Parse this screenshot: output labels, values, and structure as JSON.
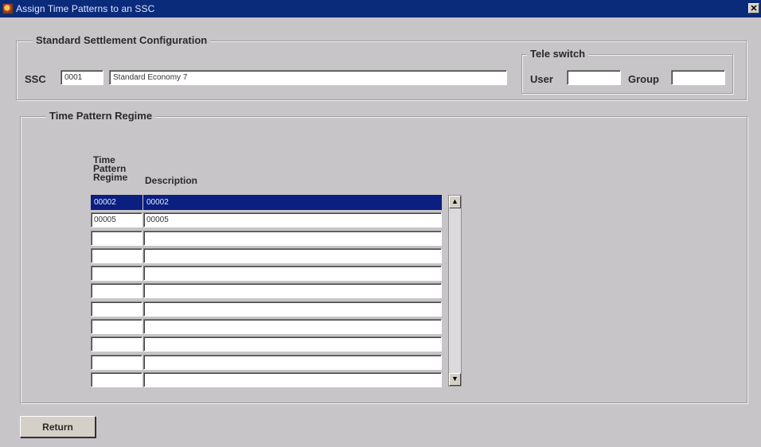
{
  "window": {
    "title": "Assign Time Patterns to an SSC",
    "close_glyph": "✕"
  },
  "ssc_group": {
    "legend": "Standard Settlement Configuration",
    "ssc_label": "SSC",
    "ssc_code": "0001",
    "ssc_description": "Standard Economy 7"
  },
  "teleswitch": {
    "legend": "Tele switch",
    "user_label": "User",
    "user_value": "",
    "group_label": "Group",
    "group_value": ""
  },
  "tpr_group": {
    "legend": "Time Pattern Regime",
    "columns": {
      "code_header_line1": "Time",
      "code_header_line2": "Pattern",
      "code_header_line3": "Regime",
      "description_header": "Description"
    },
    "rows": [
      {
        "code": "00002",
        "description": "00002"
      },
      {
        "code": "00005",
        "description": "00005"
      },
      {
        "code": "",
        "description": ""
      },
      {
        "code": "",
        "description": ""
      },
      {
        "code": "",
        "description": ""
      },
      {
        "code": "",
        "description": ""
      },
      {
        "code": "",
        "description": ""
      },
      {
        "code": "",
        "description": ""
      },
      {
        "code": "",
        "description": ""
      },
      {
        "code": "",
        "description": ""
      },
      {
        "code": "",
        "description": ""
      }
    ],
    "selected_row": 0,
    "scroll_up_glyph": "▲",
    "scroll_down_glyph": "▼"
  },
  "buttons": {
    "return_label": "Return"
  },
  "colors": {
    "titlebar": "#0a2a7a",
    "selection": "#0a1f80",
    "background": "#c8c5c8"
  }
}
